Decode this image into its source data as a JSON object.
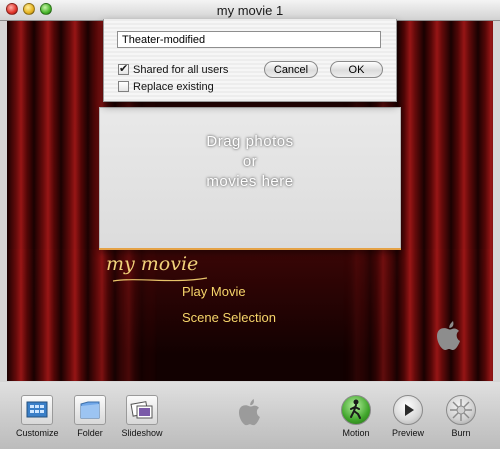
{
  "window": {
    "title": "my movie 1"
  },
  "dialog": {
    "name_value": "Theater-modified",
    "shared_label": "Shared for all users",
    "shared_checked": true,
    "replace_label": "Replace existing",
    "replace_checked": false,
    "cancel_label": "Cancel",
    "ok_label": "OK"
  },
  "stage": {
    "dropzone_text": "Drag photos\nor\nmovies here",
    "menu_title": "my movie",
    "menu_items": [
      "Play Movie",
      "Scene Selection"
    ]
  },
  "toolbar": {
    "customize_label": "Customize",
    "folder_label": "Folder",
    "slideshow_label": "Slideshow",
    "motion_label": "Motion",
    "preview_label": "Preview",
    "burn_label": "Burn"
  },
  "colors": {
    "curtain_red": "#a51818",
    "menu_text": "#f6d56a",
    "motion_green": "#3fa52a"
  }
}
